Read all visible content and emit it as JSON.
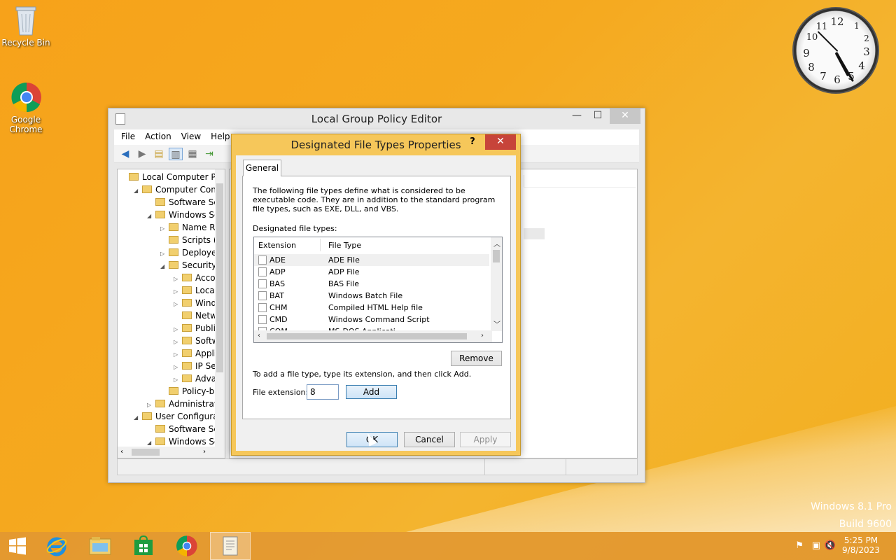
{
  "desktop": {
    "icons": [
      {
        "label": "Recycle Bin",
        "icon": "recycle-bin-icon"
      },
      {
        "label": "Google Chrome",
        "icon": "chrome-icon"
      }
    ],
    "watermark": {
      "line1": "Windows 8.1 Pro",
      "line2": "Build 9600"
    }
  },
  "clock": {
    "numbers": [
      "12",
      "1",
      "2",
      "3",
      "4",
      "5",
      "6",
      "7",
      "8",
      "9",
      "10",
      "11"
    ]
  },
  "main_window": {
    "title": "Local Group Policy Editor",
    "controls": {
      "minimize": "—",
      "maximize": "☐",
      "close": "✕"
    },
    "menu": [
      "File",
      "Action",
      "View",
      "Help"
    ],
    "tree": [
      {
        "label": "Local Computer Polic",
        "indent": 0,
        "arrow": ""
      },
      {
        "label": "Computer Config",
        "indent": 1,
        "arrow": "◢"
      },
      {
        "label": "Software Setti",
        "indent": 2,
        "arrow": ""
      },
      {
        "label": "Windows Sett",
        "indent": 2,
        "arrow": "◢"
      },
      {
        "label": "Name Res",
        "indent": 3,
        "arrow": "▷"
      },
      {
        "label": "Scripts (Sta",
        "indent": 3,
        "arrow": ""
      },
      {
        "label": "Deployed",
        "indent": 3,
        "arrow": "▷"
      },
      {
        "label": "Security Se",
        "indent": 3,
        "arrow": "◢"
      },
      {
        "label": "Accou",
        "indent": 4,
        "arrow": "▷"
      },
      {
        "label": "Local P",
        "indent": 4,
        "arrow": "▷"
      },
      {
        "label": "Windo",
        "indent": 4,
        "arrow": "▷"
      },
      {
        "label": "Netwo",
        "indent": 4,
        "arrow": ""
      },
      {
        "label": "Public",
        "indent": 4,
        "arrow": "▷"
      },
      {
        "label": "Softwa",
        "indent": 4,
        "arrow": "▷"
      },
      {
        "label": "Applic",
        "indent": 4,
        "arrow": "▷"
      },
      {
        "label": "IP Secu",
        "indent": 4,
        "arrow": "▷"
      },
      {
        "label": "Advan",
        "indent": 4,
        "arrow": "▷"
      },
      {
        "label": "Policy-bas",
        "indent": 3,
        "arrow": ""
      },
      {
        "label": "Administrative",
        "indent": 2,
        "arrow": "▷"
      },
      {
        "label": "User Configuratio",
        "indent": 1,
        "arrow": "◢"
      },
      {
        "label": "Software Setti",
        "indent": 2,
        "arrow": ""
      },
      {
        "label": "Windows Sett",
        "indent": 2,
        "arrow": "◢"
      }
    ]
  },
  "dialog": {
    "title": "Designated File Types Properties",
    "help": "?",
    "close": "✕",
    "tab": "General",
    "description": "The following file types define what is considered to be executable code. They are in addition to the standard program file types, such as EXE, DLL, and VBS.",
    "list_label": "Designated file types:",
    "columns": {
      "extension": "Extension",
      "file_type": "File Type"
    },
    "rows": [
      {
        "ext": "ADE",
        "type": "ADE File"
      },
      {
        "ext": "ADP",
        "type": "ADP File"
      },
      {
        "ext": "BAS",
        "type": "BAS File"
      },
      {
        "ext": "BAT",
        "type": "Windows Batch File"
      },
      {
        "ext": "CHM",
        "type": "Compiled HTML Help file"
      },
      {
        "ext": "CMD",
        "type": "Windows Command Script"
      },
      {
        "ext": "COM",
        "type": "MS-DOS Applicati"
      }
    ],
    "remove_button": "Remove",
    "add_hint": "To add a file type, type its extension, and then click Add.",
    "extension_label": "File extension:",
    "extension_value": "8",
    "add_button": "Add",
    "ok_button": "OK",
    "cancel_button": "Cancel",
    "apply_button": "Apply"
  },
  "taskbar": {
    "clock_time": "5:25 PM",
    "clock_date": "9/8/2023"
  },
  "colors": {
    "desktop": "#f7a21a",
    "close_red": "#c7443a",
    "dialog_frame": "#f6c75a"
  }
}
